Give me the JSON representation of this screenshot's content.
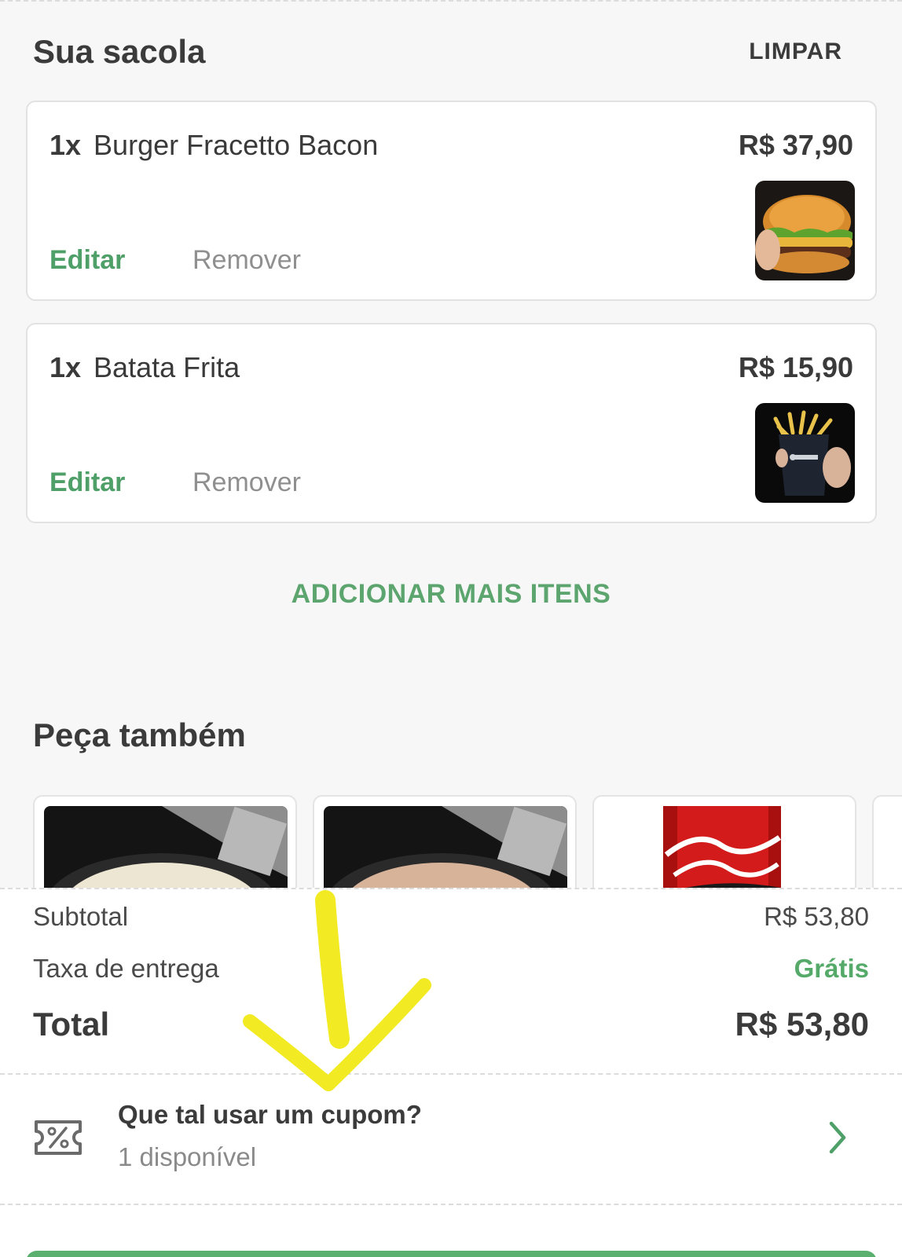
{
  "header": {
    "title": "Sua sacola",
    "clear_label": "LIMPAR"
  },
  "cart": {
    "items": [
      {
        "qty": "1x",
        "name": "Burger Fracetto Bacon",
        "price": "R$ 37,90",
        "edit_label": "Editar",
        "remove_label": "Remover",
        "image": "burger-photo"
      },
      {
        "qty": "1x",
        "name": "Batata Frita",
        "price": "R$ 15,90",
        "edit_label": "Editar",
        "remove_label": "Remover",
        "image": "fries-photo"
      }
    ],
    "add_more_label": "ADICIONAR MAIS ITENS"
  },
  "suggestions": {
    "title": "Peça também",
    "items": [
      {
        "image": "white-sauce-photo"
      },
      {
        "image": "pink-sauce-photo"
      },
      {
        "image": "coca-cola-can-photo"
      }
    ]
  },
  "summary": {
    "subtotal_label": "Subtotal",
    "subtotal_value": "R$ 53,80",
    "delivery_label": "Taxa de entrega",
    "delivery_value": "Grátis",
    "total_label": "Total",
    "total_value": "R$ 53,80"
  },
  "coupon": {
    "title": "Que tal usar um cupom?",
    "subtitle": "1 disponível",
    "icon": "coupon-icon"
  },
  "colors": {
    "accent_green": "#4f9f68",
    "annotation_yellow": "#f2ea22"
  }
}
